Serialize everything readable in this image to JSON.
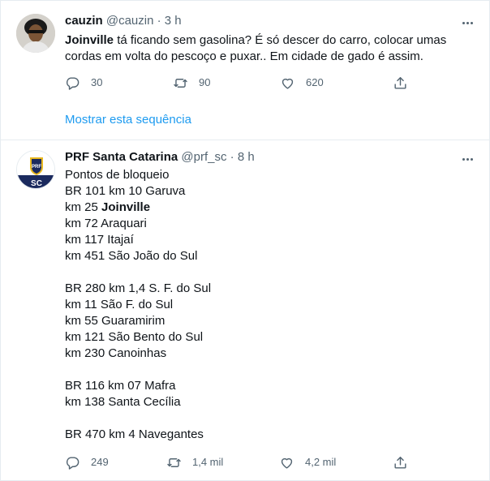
{
  "tweet1": {
    "name": "cauzin",
    "handle": "@cauzin",
    "dot": "·",
    "time": "3 h",
    "text_bold": "Joinville",
    "text_rest_line1": " tá ficando sem gasolina? É só descer do carro, colocar umas",
    "text_line2": "cordas em volta do pescoço e puxar.. Em cidade de gado é assim.",
    "replies": "30",
    "retweets": "90",
    "likes": "620",
    "show_thread": "Mostrar esta sequência"
  },
  "tweet2": {
    "name": "PRF Santa Catarina",
    "handle": "@prf_sc",
    "dot": "·",
    "time": "8 h",
    "avatar_top": "PRF",
    "avatar_bottom": "SC",
    "lines": {
      "l1": "Pontos de bloqueio",
      "l2": "BR 101 km 10 Garuva",
      "l3_prefix": "km 25 ",
      "l3_bold": "Joinville",
      "l4": "km 72 Araquari",
      "l5": "km 117 Itajaí",
      "l6": "km 451 São João do Sul",
      "l7": "BR 280 km 1,4 S. F. do Sul",
      "l8": "km 11 São F. do Sul",
      "l9": "km 55 Guaramirim",
      "l10": "km 121 São Bento do Sul",
      "l11": "km 230 Canoinhas",
      "l12": "BR 116 km 07 Mafra",
      "l13": "km 138 Santa Cecília",
      "l14": "BR 470 km 4 Navegantes"
    },
    "replies": "249",
    "retweets": "1,4 mil",
    "likes": "4,2 mil"
  },
  "colors": {
    "text": "#0f1419",
    "secondary": "#536471",
    "link": "#1d9bf0",
    "border": "#e6ecf0",
    "prf_navy": "#1b2a5e",
    "prf_gold": "#e8b820"
  }
}
